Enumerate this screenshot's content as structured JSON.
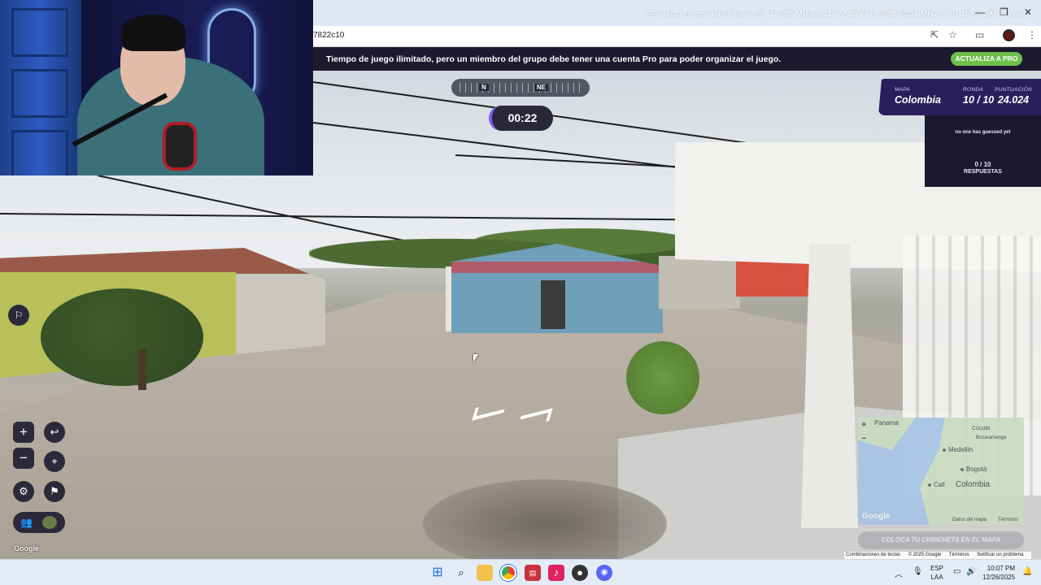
{
  "browser": {
    "url_fragment": "7822c10",
    "system_stats": "FPS 14   3 (6 ms)   GPU 13 %  47 °C  875 MHz  0.718 V  45 W  0 RPM  5001 MHz     CPU 15 %      LAT N/A  0.0",
    "minimize": "—",
    "maximize": "❐",
    "close": "✕"
  },
  "promo": {
    "text": "Tiempo de juego ilimitado, pero un miembro del grupo debe tener una cuenta Pro para poder organizar el juego.",
    "button": "ACTUALIZA A PRO"
  },
  "hud": {
    "compass_n": "N",
    "compass_ne": "NE",
    "timer": "00:22",
    "map_label": "MAPA",
    "map_value": "Colombia",
    "round_label": "RONDA",
    "round_value": "10 / 10",
    "score_label": "PUNTUACIÓN",
    "score_value": "24.024",
    "no_guess": "no one has guessed yet",
    "answers_count": "0 / 10",
    "answers_label": "RESPUESTAS",
    "google_logo": "Google"
  },
  "minimap": {
    "zoom_in": "+",
    "zoom_out": "−",
    "labels": {
      "panama": "Panama",
      "cucuta": "Cúcuta",
      "bucaramanga": "Bucaramanga",
      "medellin": "Medellín",
      "bogota": "Bogotá",
      "cali": "Cali",
      "colombia": "Colombia"
    },
    "google": "Google",
    "map_data": "Datos del mapa",
    "terms": "Términos",
    "place_pin": "COLOCA TU CHINCHETA EN EL MAPA"
  },
  "attribution": {
    "shortcuts": "Combinaciones de teclas",
    "copyright": "© 2025 Google",
    "terms": "Términos",
    "report": "Notificar un problema"
  },
  "taskbar": {
    "lang_top": "ESP",
    "lang_bottom": "LAA",
    "time": "10:07 PM",
    "date": "12/26/2025"
  },
  "colors": {
    "promo_bg": "#1d1a2f",
    "pro_button": "#6cc04a",
    "hud_purple": "#2a1f5c",
    "timer_accent": "#7a5af5"
  }
}
